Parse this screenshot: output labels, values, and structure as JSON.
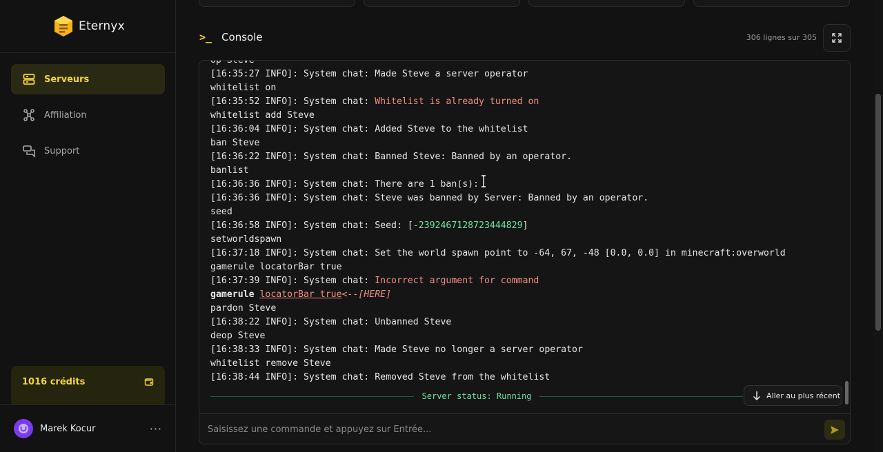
{
  "app": {
    "name": "Eternyx"
  },
  "sidebar": {
    "items": [
      {
        "label": "Serveurs",
        "icon": "server-icon",
        "active": true
      },
      {
        "label": "Affiliation",
        "icon": "share-nodes-icon",
        "active": false
      },
      {
        "label": "Support",
        "icon": "chat-bubbles-icon",
        "active": false
      }
    ],
    "credits": {
      "label": "1016 crédits",
      "icon": "wallet-icon"
    },
    "user": {
      "name": "Marek Kocur",
      "menu": "···"
    }
  },
  "console": {
    "prompt_glyph": ">_",
    "title": "Console",
    "lines_count": "306 lignes sur 305",
    "fullscreen_icon": "expand-icon",
    "status": "Server status: Running",
    "latest_button": "Aller au plus récent",
    "input_placeholder": "Saisissez une commande et appuyez sur Entrée...",
    "log": [
      {
        "text": "op Steve",
        "style": "plain"
      },
      {
        "prefix": "[16:35:27 INFO]: System chat: ",
        "text": "Made Steve a server operator",
        "style": "plain"
      },
      {
        "text": "whitelist on",
        "style": "plain"
      },
      {
        "prefix": "[16:35:52 INFO]: System chat: ",
        "text": "Whitelist is already turned on",
        "style": "red"
      },
      {
        "text": "whitelist add Steve",
        "style": "plain"
      },
      {
        "prefix": "[16:36:04 INFO]: System chat: ",
        "text": "Added Steve to the whitelist",
        "style": "plain"
      },
      {
        "text": "ban Steve",
        "style": "plain"
      },
      {
        "prefix": "[16:36:22 INFO]: System chat: ",
        "text": "Banned Steve: Banned by an operator.",
        "style": "plain"
      },
      {
        "text": "banlist",
        "style": "plain"
      },
      {
        "prefix": "[16:36:36 INFO]: System chat: ",
        "text": "There are 1 ban(s):",
        "style": "plain"
      },
      {
        "prefix": "[16:36:36 INFO]: System chat: ",
        "text": "Steve was banned by Server: Banned by an operator.",
        "style": "plain"
      },
      {
        "text": "seed",
        "style": "plain"
      },
      {
        "prefix": "[16:36:58 INFO]: System chat: ",
        "text": "Seed: [",
        "seed": "-2392467128723444829",
        "suffix": "]",
        "style": "seed"
      },
      {
        "text": "setworldspawn",
        "style": "plain"
      },
      {
        "prefix": "[16:37:18 INFO]: System chat: ",
        "text": "Set the world spawn point to -64, 67, -48 [0.0, 0.0] in minecraft:overworld",
        "style": "plain"
      },
      {
        "text": "gamerule locatorBar true",
        "style": "plain"
      },
      {
        "prefix": "[16:37:39 INFO]: System chat: ",
        "text": "Incorrect argument for command",
        "style": "red"
      },
      {
        "text": "gamerule ",
        "err": "locatorBar true",
        "here": "<--[HERE]",
        "style": "error-marker"
      },
      {
        "text": "pardon Steve",
        "style": "plain"
      },
      {
        "prefix": "[16:38:22 INFO]: System chat: ",
        "text": "Unbanned Steve",
        "style": "plain"
      },
      {
        "text": "deop Steve",
        "style": "plain"
      },
      {
        "prefix": "[16:38:33 INFO]: System chat: ",
        "text": "Made Steve no longer a server operator",
        "style": "plain"
      },
      {
        "text": "whitelist remove Steve",
        "style": "plain"
      },
      {
        "prefix": "[16:38:44 INFO]: System chat: ",
        "text": "Removed Steve from the whitelist",
        "style": "plain"
      }
    ]
  },
  "colors": {
    "accent": "#f4d63a",
    "error": "#f28b82",
    "success": "#6fe3a6"
  }
}
